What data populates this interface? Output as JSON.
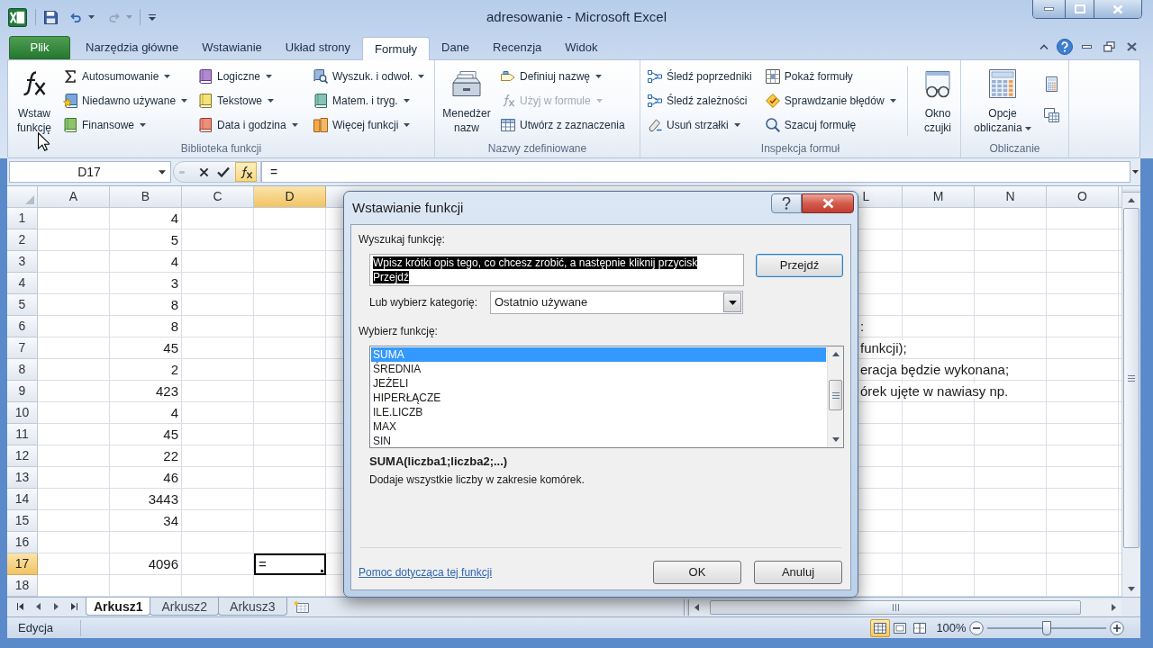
{
  "window": {
    "title": "adresowanie - Microsoft Excel"
  },
  "ribbon_tabs": [
    {
      "label": "Plik",
      "kind": "file",
      "selected": false
    },
    {
      "label": "Narzędzia główne",
      "kind": "tab",
      "selected": false
    },
    {
      "label": "Wstawianie",
      "kind": "tab",
      "selected": false
    },
    {
      "label": "Układ strony",
      "kind": "tab",
      "selected": false
    },
    {
      "label": "Formuły",
      "kind": "tab",
      "selected": true
    },
    {
      "label": "Dane",
      "kind": "tab",
      "selected": false
    },
    {
      "label": "Recenzja",
      "kind": "tab",
      "selected": false
    },
    {
      "label": "Widok",
      "kind": "tab",
      "selected": false
    }
  ],
  "ribbon_groups": [
    {
      "label": "Biblioteka funkcji",
      "columns": [
        [
          {
            "kind": "large",
            "lines": [
              "Wstaw",
              "funkcję"
            ],
            "dropdown": false,
            "disabled": false
          }
        ],
        [
          {
            "kind": "small",
            "label": "Autosumowanie",
            "dropdown": true,
            "disabled": false
          },
          {
            "kind": "small",
            "label": "Niedawno używane",
            "dropdown": true,
            "disabled": false
          },
          {
            "kind": "small",
            "label": "Finansowe",
            "dropdown": true,
            "disabled": false
          }
        ],
        [
          {
            "kind": "small",
            "label": "Logiczne",
            "dropdown": true,
            "disabled": false
          },
          {
            "kind": "small",
            "label": "Tekstowe",
            "dropdown": true,
            "disabled": false
          },
          {
            "kind": "small",
            "label": "Data i godzina",
            "dropdown": true,
            "disabled": false
          }
        ],
        [
          {
            "kind": "small",
            "label": "Wyszuk. i odwoł.",
            "dropdown": true,
            "disabled": false
          },
          {
            "kind": "small",
            "label": "Matem. i tryg.",
            "dropdown": true,
            "disabled": false
          },
          {
            "kind": "small",
            "label": "Więcej funkcji",
            "dropdown": true,
            "disabled": false
          }
        ]
      ]
    },
    {
      "label": "Nazwy zdefiniowane",
      "columns": [
        [
          {
            "kind": "large",
            "lines": [
              "Menedżer",
              "nazw"
            ],
            "dropdown": false,
            "disabled": false
          }
        ],
        [
          {
            "kind": "small",
            "label": "Definiuj nazwę",
            "dropdown": true,
            "disabled": false
          },
          {
            "kind": "small",
            "label": "Użyj w formule",
            "dropdown": true,
            "disabled": true
          },
          {
            "kind": "small",
            "label": "Utwórz z zaznaczenia",
            "dropdown": false,
            "disabled": false
          }
        ]
      ]
    },
    {
      "label": "Inspekcja formuł",
      "columns": [
        [
          {
            "kind": "small",
            "label": "Śledź poprzedniki",
            "dropdown": false,
            "disabled": false
          },
          {
            "kind": "small",
            "label": "Śledź zależności",
            "dropdown": false,
            "disabled": false
          },
          {
            "kind": "small",
            "label": "Usuń strzałki",
            "dropdown": true,
            "disabled": false
          }
        ],
        [
          {
            "kind": "small",
            "label": "Pokaż formuły",
            "dropdown": false,
            "disabled": false
          },
          {
            "kind": "small",
            "label": "Sprawdzanie błędów",
            "dropdown": true,
            "disabled": false
          },
          {
            "kind": "small",
            "label": "Szacuj formułę",
            "dropdown": false,
            "disabled": false
          }
        ],
        [
          {
            "kind": "large",
            "lines": [
              "Okno",
              "czujki"
            ],
            "dropdown": false,
            "disabled": false
          }
        ]
      ]
    },
    {
      "label": "Obliczanie",
      "columns": [
        [
          {
            "kind": "large",
            "lines": [
              "Opcje",
              "obliczania"
            ],
            "dropdown": true,
            "disabled": false
          }
        ],
        [
          {
            "kind": "icon"
          },
          {
            "kind": "icon"
          }
        ]
      ]
    }
  ],
  "formula_bar": {
    "name_box": "D17",
    "formula": "="
  },
  "sheet": {
    "columns_left": [
      {
        "label": "A",
        "selected": false
      },
      {
        "label": "B",
        "selected": false
      },
      {
        "label": "C",
        "selected": false
      },
      {
        "label": "D",
        "selected": true
      }
    ],
    "columns_right": [
      {
        "label": "L",
        "selected": false
      },
      {
        "label": "M",
        "selected": false
      },
      {
        "label": "N",
        "selected": false
      },
      {
        "label": "O",
        "selected": false
      }
    ],
    "rows": [
      {
        "number": "1",
        "selected": false,
        "b": "4"
      },
      {
        "number": "2",
        "selected": false,
        "b": "5"
      },
      {
        "number": "3",
        "selected": false,
        "b": "4"
      },
      {
        "number": "4",
        "selected": false,
        "b": "3"
      },
      {
        "number": "5",
        "selected": false,
        "b": "8"
      },
      {
        "number": "6",
        "selected": false,
        "b": "8",
        "partial_text": ":"
      },
      {
        "number": "7",
        "selected": false,
        "b": "45",
        "partial_text": "funkcji);"
      },
      {
        "number": "8",
        "selected": false,
        "b": "2",
        "partial_text": "eracja będzie wykonana;"
      },
      {
        "number": "9",
        "selected": false,
        "b": "423",
        "partial_text": "órek ujęte w nawiasy np."
      },
      {
        "number": "10",
        "selected": false,
        "b": "4"
      },
      {
        "number": "11",
        "selected": false,
        "b": "45"
      },
      {
        "number": "12",
        "selected": false,
        "b": "22"
      },
      {
        "number": "13",
        "selected": false,
        "b": "46"
      },
      {
        "number": "14",
        "selected": false,
        "b": "3443"
      },
      {
        "number": "15",
        "selected": false,
        "b": "34"
      },
      {
        "number": "16",
        "selected": false
      },
      {
        "number": "17",
        "selected": true,
        "b": "4096",
        "d": "="
      },
      {
        "number": "18",
        "selected": false
      }
    ]
  },
  "sheet_tabs": [
    {
      "label": "Arkusz1",
      "selected": true
    },
    {
      "label": "Arkusz2",
      "selected": false
    },
    {
      "label": "Arkusz3",
      "selected": false
    }
  ],
  "status_bar": {
    "mode": "Edycja",
    "view_buttons": [
      {
        "selected": true
      },
      {
        "selected": false
      },
      {
        "selected": false
      }
    ],
    "zoom": "100%",
    "zoom_slider": {
      "level": 0.5
    }
  },
  "dialog": {
    "title": "Wstawianie funkcji",
    "search_label": "Wyszukaj funkcję:",
    "search_value": "Wpisz krótki opis tego, co chcesz zrobić, a następnie kliknij przycisk Przejdź",
    "search_value_selected": true,
    "go_button": {
      "label": "Przejdź",
      "default": true
    },
    "category_label": "Lub wybierz kategorię:",
    "category_value": "Ostatnio używane",
    "list_label": "Wybierz funkcję:",
    "functions": [
      {
        "name": "SUMA",
        "selected": true
      },
      {
        "name": "ŚREDNIA",
        "selected": false
      },
      {
        "name": "JEŻELI",
        "selected": false
      },
      {
        "name": "HIPERŁĄCZE",
        "selected": false
      },
      {
        "name": "ILE.LICZB",
        "selected": false
      },
      {
        "name": "MAX",
        "selected": false
      },
      {
        "name": "SIN",
        "selected": false
      }
    ],
    "signature": "SUMA(liczba1;liczba2;...)",
    "description": "Dodaje wszystkie liczby w zakresie komórek.",
    "help_link": "Pomoc dotycząca tej funkcji",
    "buttons": [
      {
        "label": "OK",
        "default": false
      },
      {
        "label": "Anuluj",
        "default": false
      }
    ]
  }
}
